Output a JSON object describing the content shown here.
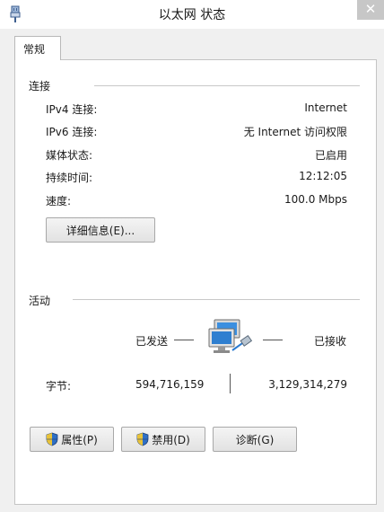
{
  "window": {
    "title": "以太网 状态",
    "close_glyph": "✕"
  },
  "tabs": [
    {
      "label": "常规"
    }
  ],
  "connection": {
    "heading": "连接",
    "rows": [
      {
        "label": "IPv4 连接:",
        "value": "Internet"
      },
      {
        "label": "IPv6 连接:",
        "value": "无 Internet 访问权限"
      },
      {
        "label": "媒体状态:",
        "value": "已启用"
      },
      {
        "label": "持续时间:",
        "value": "12:12:05"
      },
      {
        "label": "速度:",
        "value": "100.0 Mbps"
      }
    ],
    "details_button": "详细信息(E)..."
  },
  "activity": {
    "heading": "活动",
    "sent_label": "已发送",
    "received_label": "已接收",
    "bytes_label": "字节:",
    "bytes_sent": "594,716,159",
    "bytes_received": "3,129,314,279"
  },
  "buttons": {
    "properties": "属性(P)",
    "disable": "禁用(D)",
    "diagnose": "诊断(G)"
  },
  "icons": {
    "window": "network-adapter-icon",
    "activity": "network-computers-icon",
    "shield": "uac-shield-icon"
  },
  "colors": {
    "panel_bg": "#ffffff",
    "window_bg": "#f0f0f0",
    "close_button_bg": "#c7c7c7",
    "monitor_blue": "#2f7fd0"
  }
}
